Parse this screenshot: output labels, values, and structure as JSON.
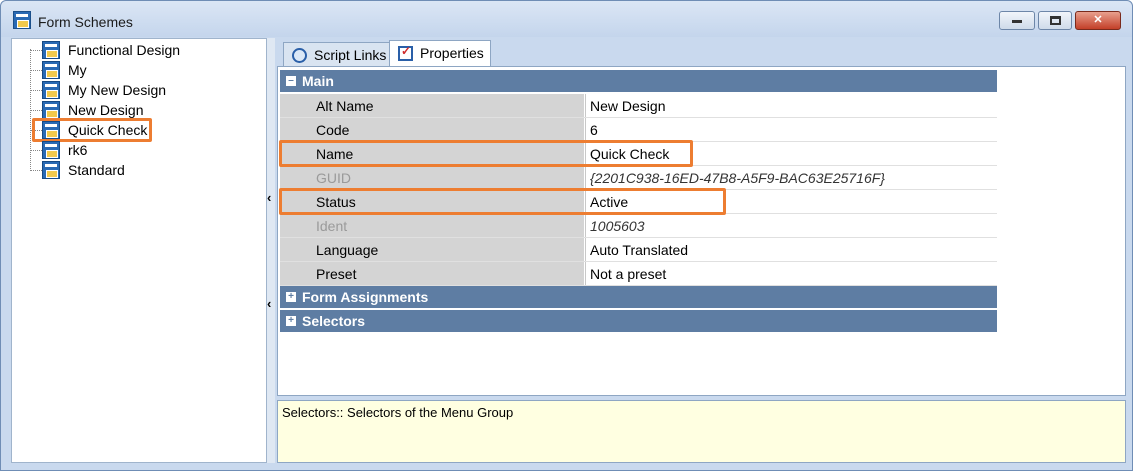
{
  "window": {
    "title": "Form Schemes",
    "minimize_label": "",
    "maximize_label": "",
    "close_label": "✕"
  },
  "tree": {
    "items": [
      {
        "label": "Functional Design"
      },
      {
        "label": "My"
      },
      {
        "label": "My New Design"
      },
      {
        "label": "New Design"
      },
      {
        "label": "Quick Check",
        "selected": true
      },
      {
        "label": "rk6"
      },
      {
        "label": "Standard"
      }
    ]
  },
  "tabs": [
    {
      "label": "Script Links",
      "icon": "script-links-icon"
    },
    {
      "label": "Properties",
      "icon": "properties-icon",
      "active": true
    }
  ],
  "grid": {
    "main_category": "Main",
    "rows": [
      {
        "name": "Alt Name",
        "value": "New Design"
      },
      {
        "name": "Code",
        "value": "6"
      },
      {
        "name": "Name",
        "value": "Quick Check"
      },
      {
        "name": "GUID",
        "value": "{2201C938-16ED-47B8-A5F9-BAC63E25716F}"
      },
      {
        "name": "Status",
        "value": "Active"
      },
      {
        "name": "Ident",
        "value": "1005603"
      },
      {
        "name": "Language",
        "value": "Auto Translated"
      },
      {
        "name": "Preset",
        "value": "Not a preset"
      }
    ],
    "collapsed_categories": [
      "Form Assignments",
      "Selectors"
    ]
  },
  "description": "Selectors:: Selectors of the Menu Group",
  "colors": {
    "category_bg": "#5e7da3",
    "highlight": "#ed7d31",
    "description_bg": "#ffffe1"
  }
}
